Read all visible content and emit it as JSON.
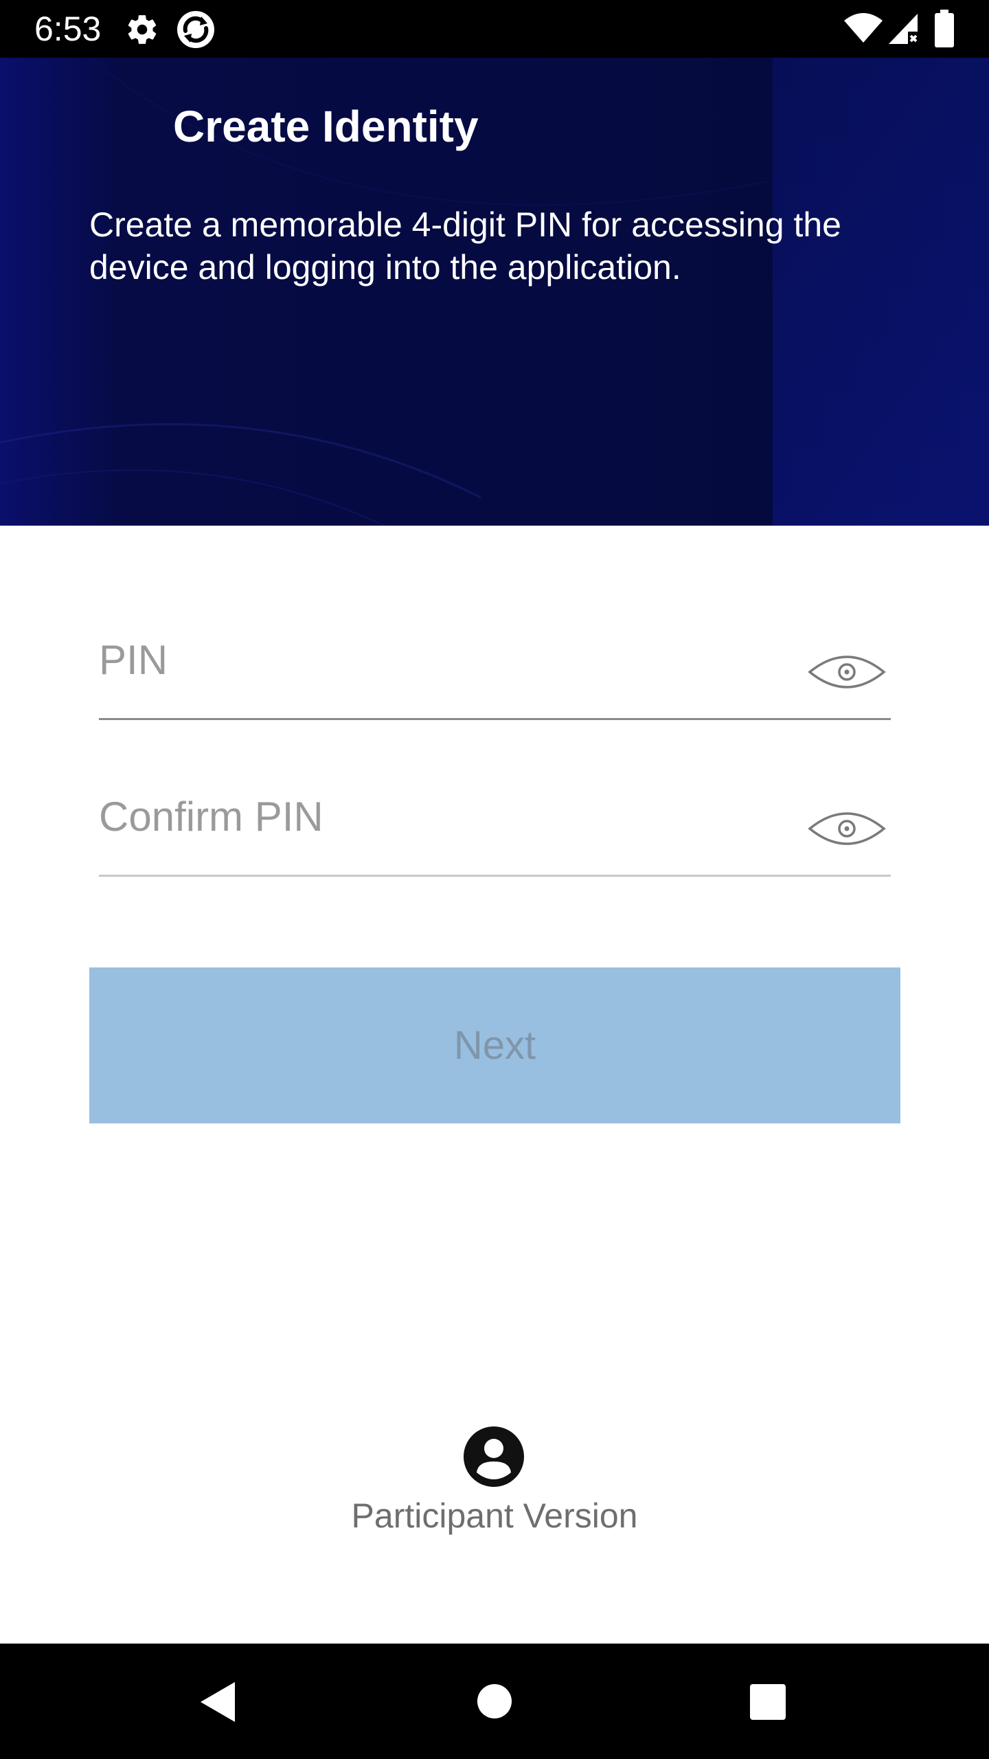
{
  "status_bar": {
    "time": "6:53",
    "icons": [
      "settings-icon",
      "sync-app-icon",
      "wifi-icon",
      "signal-icon",
      "battery-icon"
    ]
  },
  "header": {
    "title": "Create Identity",
    "description": "Create a memorable 4-digit PIN for accessing the device and logging into the application."
  },
  "form": {
    "pin_placeholder": "PIN",
    "confirm_placeholder": "Confirm PIN",
    "next_label": "Next"
  },
  "footer": {
    "participant_label": "Participant Version",
    "icon": "account-circle-icon"
  },
  "nav_bar": {
    "buttons": [
      "back-icon",
      "home-icon",
      "recents-icon"
    ]
  },
  "colors": {
    "header_bg": "#050a40",
    "button_bg": "#98bfe0",
    "button_text": "#7f96ab",
    "placeholder": "#9a9a9a"
  }
}
